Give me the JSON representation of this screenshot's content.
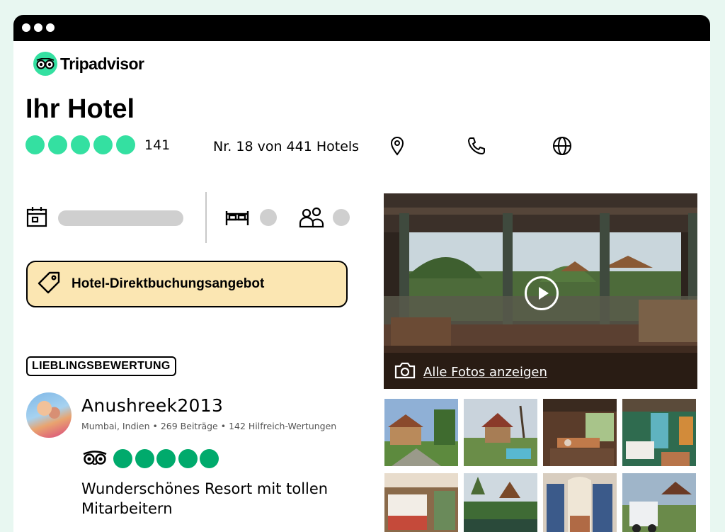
{
  "brand": {
    "name": "Tripadvisor"
  },
  "hotel": {
    "title": "Ihr Hotel",
    "rating": 5,
    "review_count": "141",
    "rank": "Nr. 18 von 441 Hotels"
  },
  "booking": {
    "deal_label": "Hotel-Direktbuchungsangebot"
  },
  "review": {
    "badge": "LIEBLINGSBEWERTUNG",
    "user_name": "Anushreek2013",
    "user_meta": "Mumbai, Indien • 269 Beiträge • 142 Hilfreich-Wertungen",
    "rating": 5,
    "title": "Wunderschönes Resort mit tollen Mitarbeitern"
  },
  "gallery": {
    "photos_link": "Alle Fotos anzeigen"
  },
  "colors": {
    "brand_green": "#34e0a1",
    "review_green": "#00aa6c",
    "deal_bg": "#fbe6b2"
  },
  "icons": [
    "location-pin-icon",
    "phone-icon",
    "globe-icon",
    "calendar-icon",
    "bed-icon",
    "guests-icon",
    "price-tag-icon",
    "owl-icon",
    "camera-icon",
    "play-icon"
  ]
}
